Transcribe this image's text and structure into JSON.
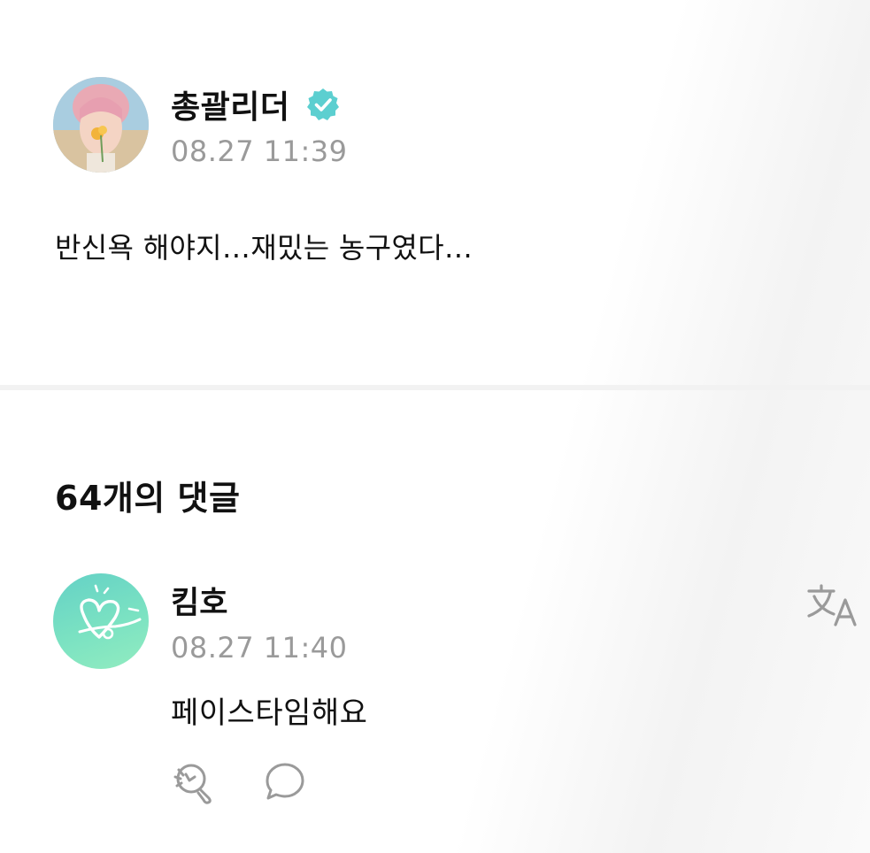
{
  "post": {
    "author": "총괄리더",
    "verified": true,
    "time": "08.27 11:39",
    "body": "반신욕 해야지…재밌는 농구였다…"
  },
  "comments_header": {
    "count_label": "64개의 댓글"
  },
  "comments": [
    {
      "author": "킴호",
      "time": "08.27 11:40",
      "text": "페이스타임해요"
    }
  ],
  "icons": {
    "verified": "verified-badge-icon",
    "translate": "translate-icon",
    "like": "like-reaction-icon",
    "reply": "reply-bubble-icon"
  },
  "colors": {
    "verified_badge": "#5ccfd0",
    "meta_text": "#9a9a9a",
    "comment_avatar": "#7be2c2"
  }
}
